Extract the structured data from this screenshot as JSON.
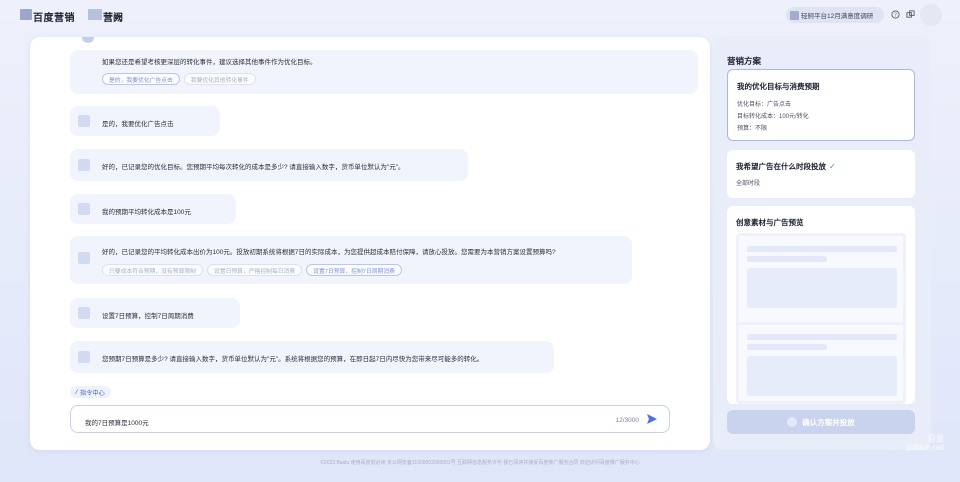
{
  "header": {
    "brand": "百度营销",
    "brand_sub": "营阙",
    "survey_text": "轻舸平台12月满意度调研",
    "help_icon": "help-circle-icon",
    "copy_icon": "window-icon"
  },
  "chat": {
    "intro_text": "如果您还是希望考核更深层的转化事件，建议选择其他事件作为优化目标。",
    "intro_options": [
      "是的，我要优化广告点击",
      "我要优化其他转化事件"
    ],
    "messages": [
      {
        "text": "是的，我要优化广告点击"
      },
      {
        "text": "好的，已记录您的优化目标。您预期平均每次转化的成本是多少? 请直接输入数字，货币单位默认为\"元\"。"
      },
      {
        "text": "我的预期平均转化成本是100元"
      },
      {
        "text": "好的，已记录您的平均转化成本出价为100元。投放初期系统将根据7日的实际成本，为您提供超成本赔付保障，请放心投放。您需要为本营销方案设置预算吗?"
      },
      {
        "text": "设置7日预算，控制7日周期消费"
      },
      {
        "text": "您预期7日预算是多少? 请直接输入数字，货币单位默认为\"元\"。系统将根据您的预算，在即日起7日内尽快为您带来尽可能多的转化。"
      }
    ],
    "budget_options": [
      "只要成本符合预期，没有预算限制",
      "设置日预算，严格控制每日消费",
      "设置7日预算，控制7日周期消费"
    ],
    "command_center": "指令中心",
    "input_value": "我的7日预算是1000元",
    "counter": "12/3000"
  },
  "plan": {
    "title": "营销方案",
    "card1": {
      "title": "我的优化目标与消费预期",
      "lines": [
        "优化目标：广告点击",
        "目标转化成本：100元/转化",
        "预算：不限"
      ]
    },
    "card2": {
      "title": "我希望广告在什么时段投放",
      "line": "全部时段"
    },
    "card3": {
      "title": "创意素材与广告预览"
    },
    "confirm_label": "确认方案并投放"
  },
  "footer": "©2023 Baidu 使用百度前必读 京公网安备11000002000001号 互联网信息服务许可 我已阅读并接受百度推广服务合同 欢迎访问百度推广服务中心",
  "watermark": [
    "巨量",
    "jb9bun.net"
  ],
  "colors": {
    "accent": "#4a6ef0",
    "success": "#22b07d"
  }
}
